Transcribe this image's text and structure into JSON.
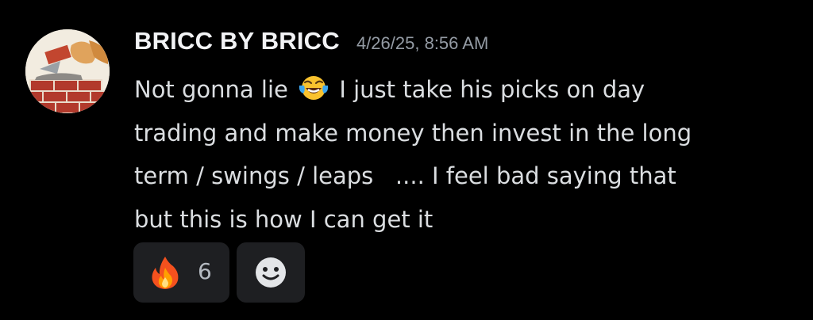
{
  "message": {
    "author": "BRICC BY BRICC",
    "timestamp": "4/26/25, 8:56 AM",
    "lines": [
      {
        "before": "Not gonna lie",
        "emoji": "face-with-tears-of-joy-emoji",
        "after": "I just take his picks on day"
      },
      "trading and make money then invest in the long",
      "term / swings / leaps   .... I feel bad saying that",
      "but this is how I can get it"
    ],
    "avatar_icon": "bricklayer-avatar"
  },
  "reactions": [
    {
      "emoji": "fire-emoji",
      "count": "6"
    },
    {
      "emoji": "add-reaction-smiley-icon"
    }
  ],
  "colors": {
    "background": "#000000",
    "username": "#f2f3f5",
    "timestamp": "#949ba4",
    "text": "#dbdee1",
    "reaction_bg": "#1e1f22"
  }
}
